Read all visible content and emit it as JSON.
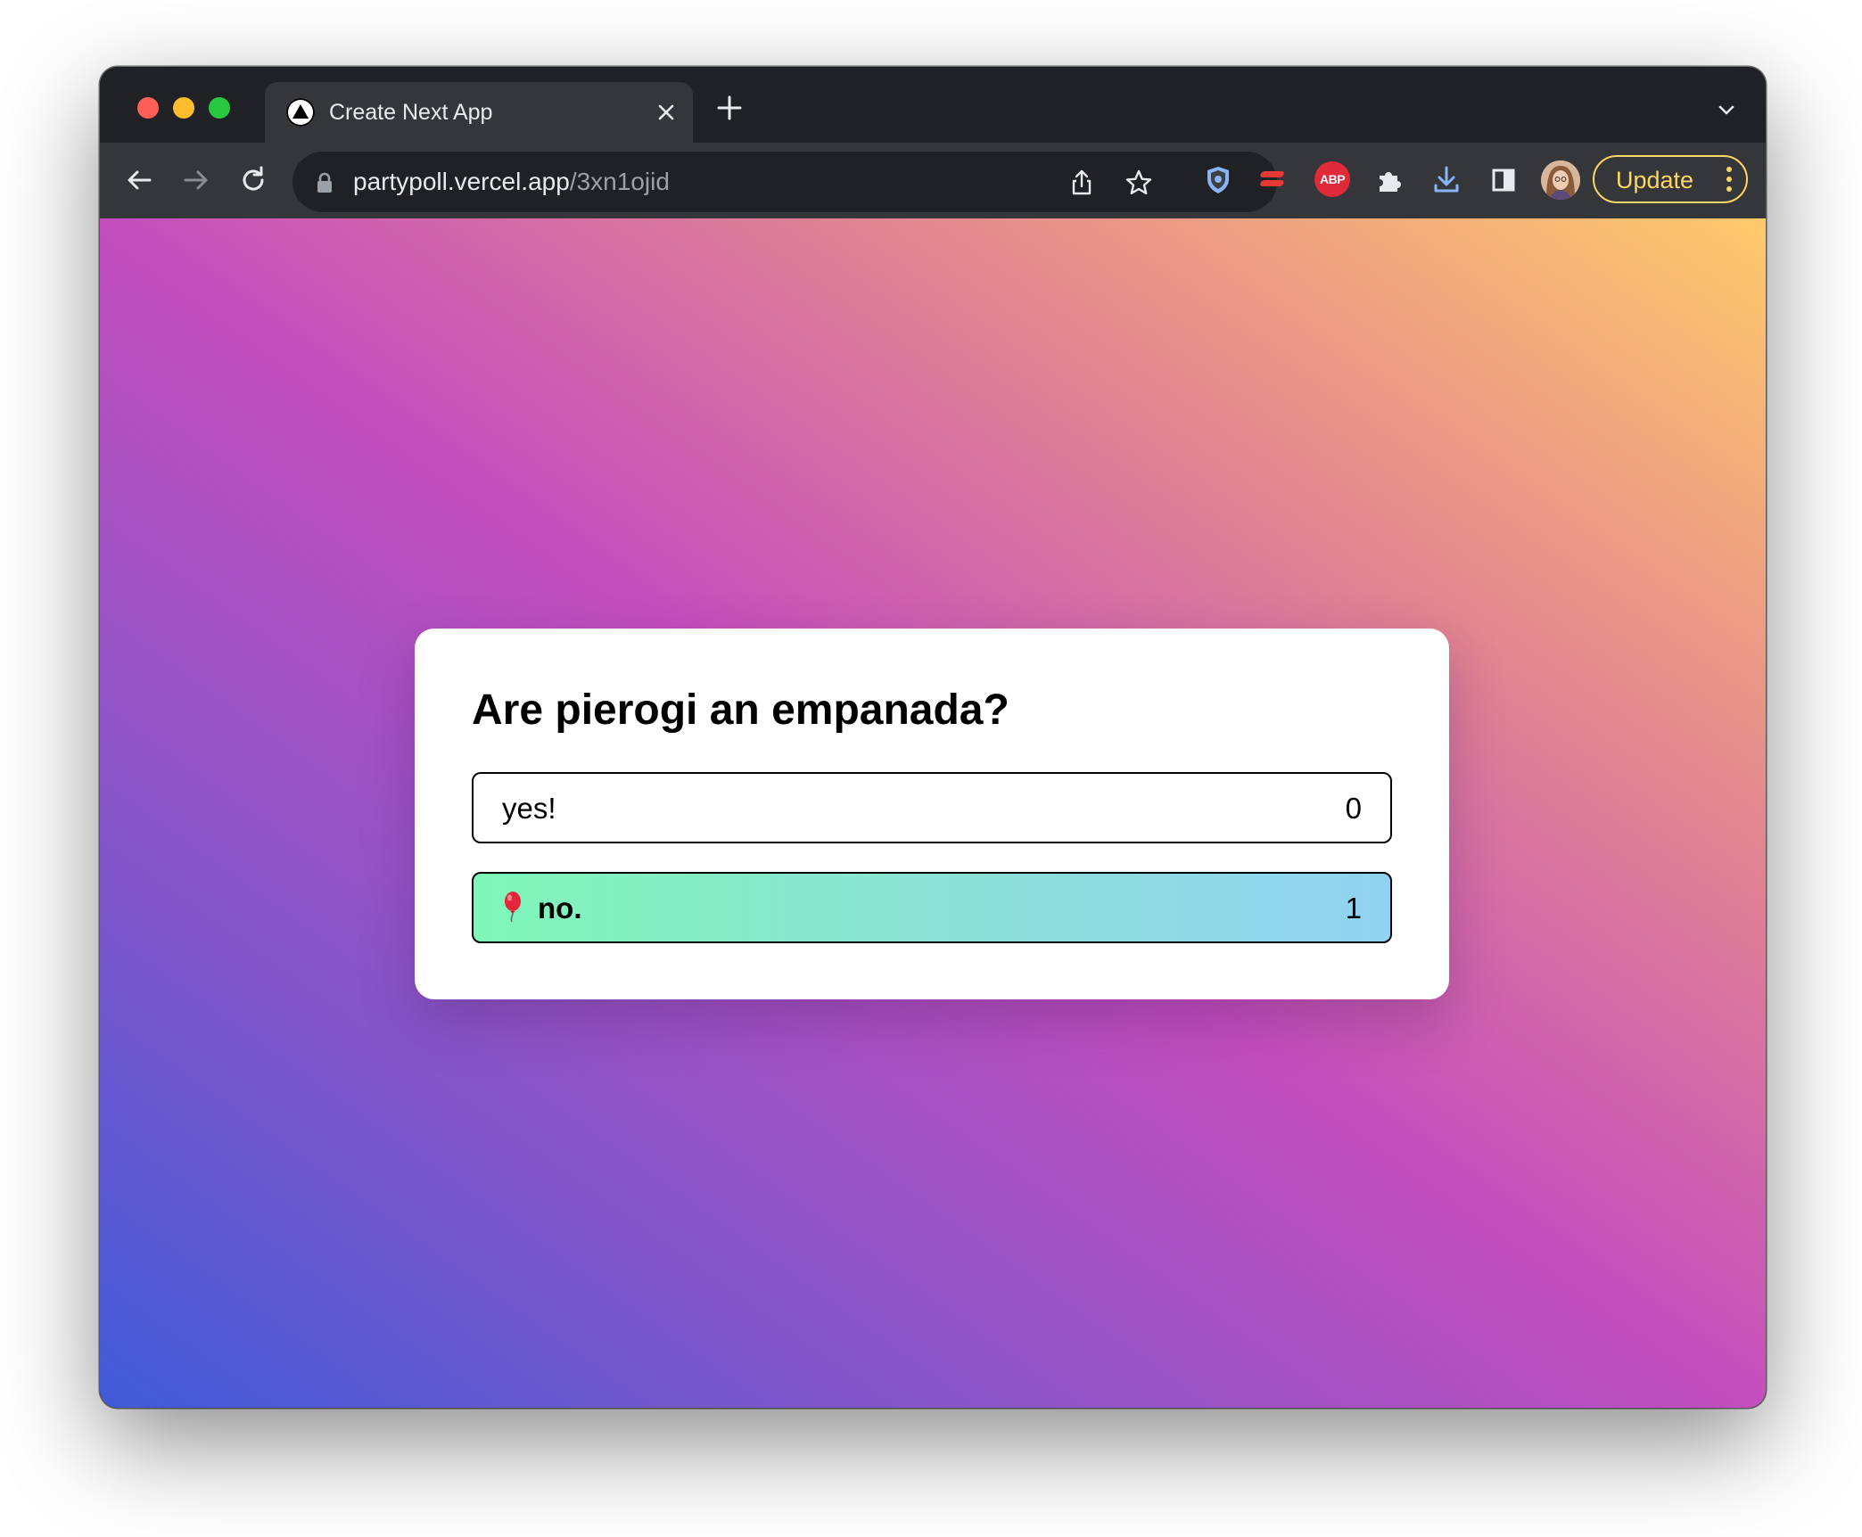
{
  "browser": {
    "tab_title": "Create Next App",
    "url_host": "partypoll.vercel.app",
    "url_path": "/3xn1ojid",
    "abp_badge": "ABP",
    "update_label": "Update"
  },
  "poll": {
    "question": "Are pierogi an empanada?",
    "options": [
      {
        "label": "yes!",
        "votes": "0",
        "selected": false
      },
      {
        "label": "no.",
        "votes": "1",
        "selected": true,
        "marker_icon": "balloon-icon"
      }
    ]
  },
  "colors": {
    "selected_option_gradient": [
      "#7ff7b8",
      "#91d2f2"
    ],
    "update_accent": "#fdd663",
    "background_gradient": [
      "#3f5bd8",
      "#c44ebd",
      "#ffca6b"
    ]
  }
}
